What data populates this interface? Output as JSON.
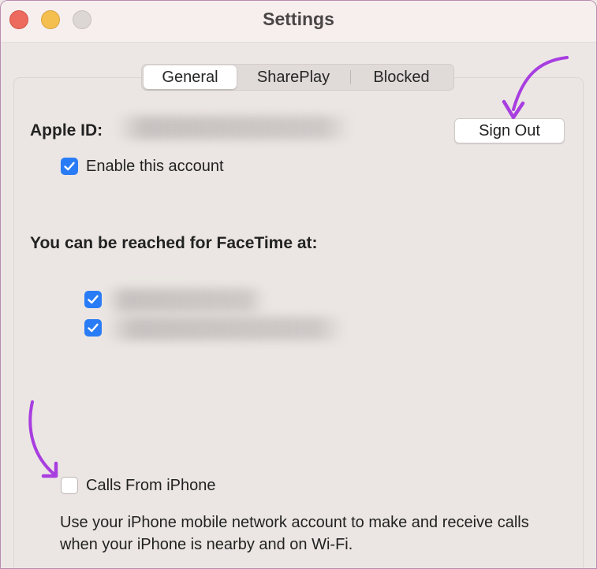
{
  "window": {
    "title": "Settings"
  },
  "tabs": [
    {
      "label": "General",
      "active": true
    },
    {
      "label": "SharePlay",
      "active": false
    },
    {
      "label": "Blocked",
      "active": false
    }
  ],
  "account": {
    "apple_id_label": "Apple ID:",
    "sign_out_label": "Sign Out",
    "enable_label": "Enable this account",
    "enable_checked": true
  },
  "reach": {
    "heading": "You can be reached for FaceTime at:",
    "addresses": [
      {
        "checked": true
      },
      {
        "checked": true
      }
    ]
  },
  "calls": {
    "label": "Calls From iPhone",
    "checked": false,
    "description": "Use your iPhone mobile network account to make and receive calls when your iPhone is nearby and on Wi-Fi."
  },
  "colors": {
    "accent": "#2a7cf6",
    "annotation_arrow": "#a83ee0",
    "close": "#ed6a5e",
    "minimize": "#f5bf4f"
  }
}
